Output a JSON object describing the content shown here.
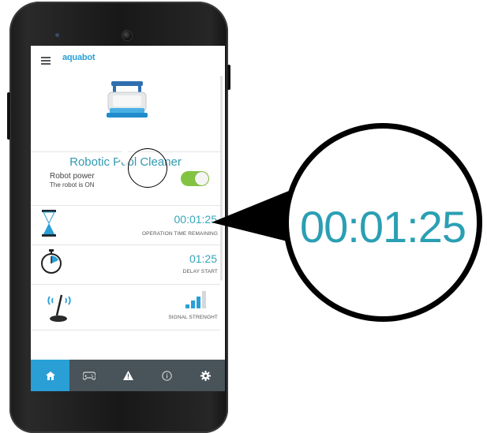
{
  "app": {
    "logo": "aquabot",
    "hero_title": "Robotic Pool Cleaner"
  },
  "power": {
    "label": "Robot power",
    "status": "The robot is ON",
    "toggle_on": true
  },
  "operation": {
    "value": "00:01:25",
    "caption": "OPERATION TIME REMAINING"
  },
  "delay": {
    "value": "01:25",
    "caption": "DELAY START"
  },
  "signal": {
    "caption": "SIGNAL STRENGHT"
  },
  "nav": [
    {
      "icon": "home-icon",
      "active": true
    },
    {
      "icon": "gamepad-icon",
      "active": false
    },
    {
      "icon": "warning-icon",
      "active": false
    },
    {
      "icon": "info-icon",
      "active": false
    },
    {
      "icon": "gear-icon",
      "active": false
    }
  ],
  "magnified": {
    "value": "00:01:25"
  },
  "colors": {
    "accent": "#35a6bb",
    "brand": "#2a9fd6",
    "toggle": "#82c341",
    "navbar": "#48535a"
  }
}
